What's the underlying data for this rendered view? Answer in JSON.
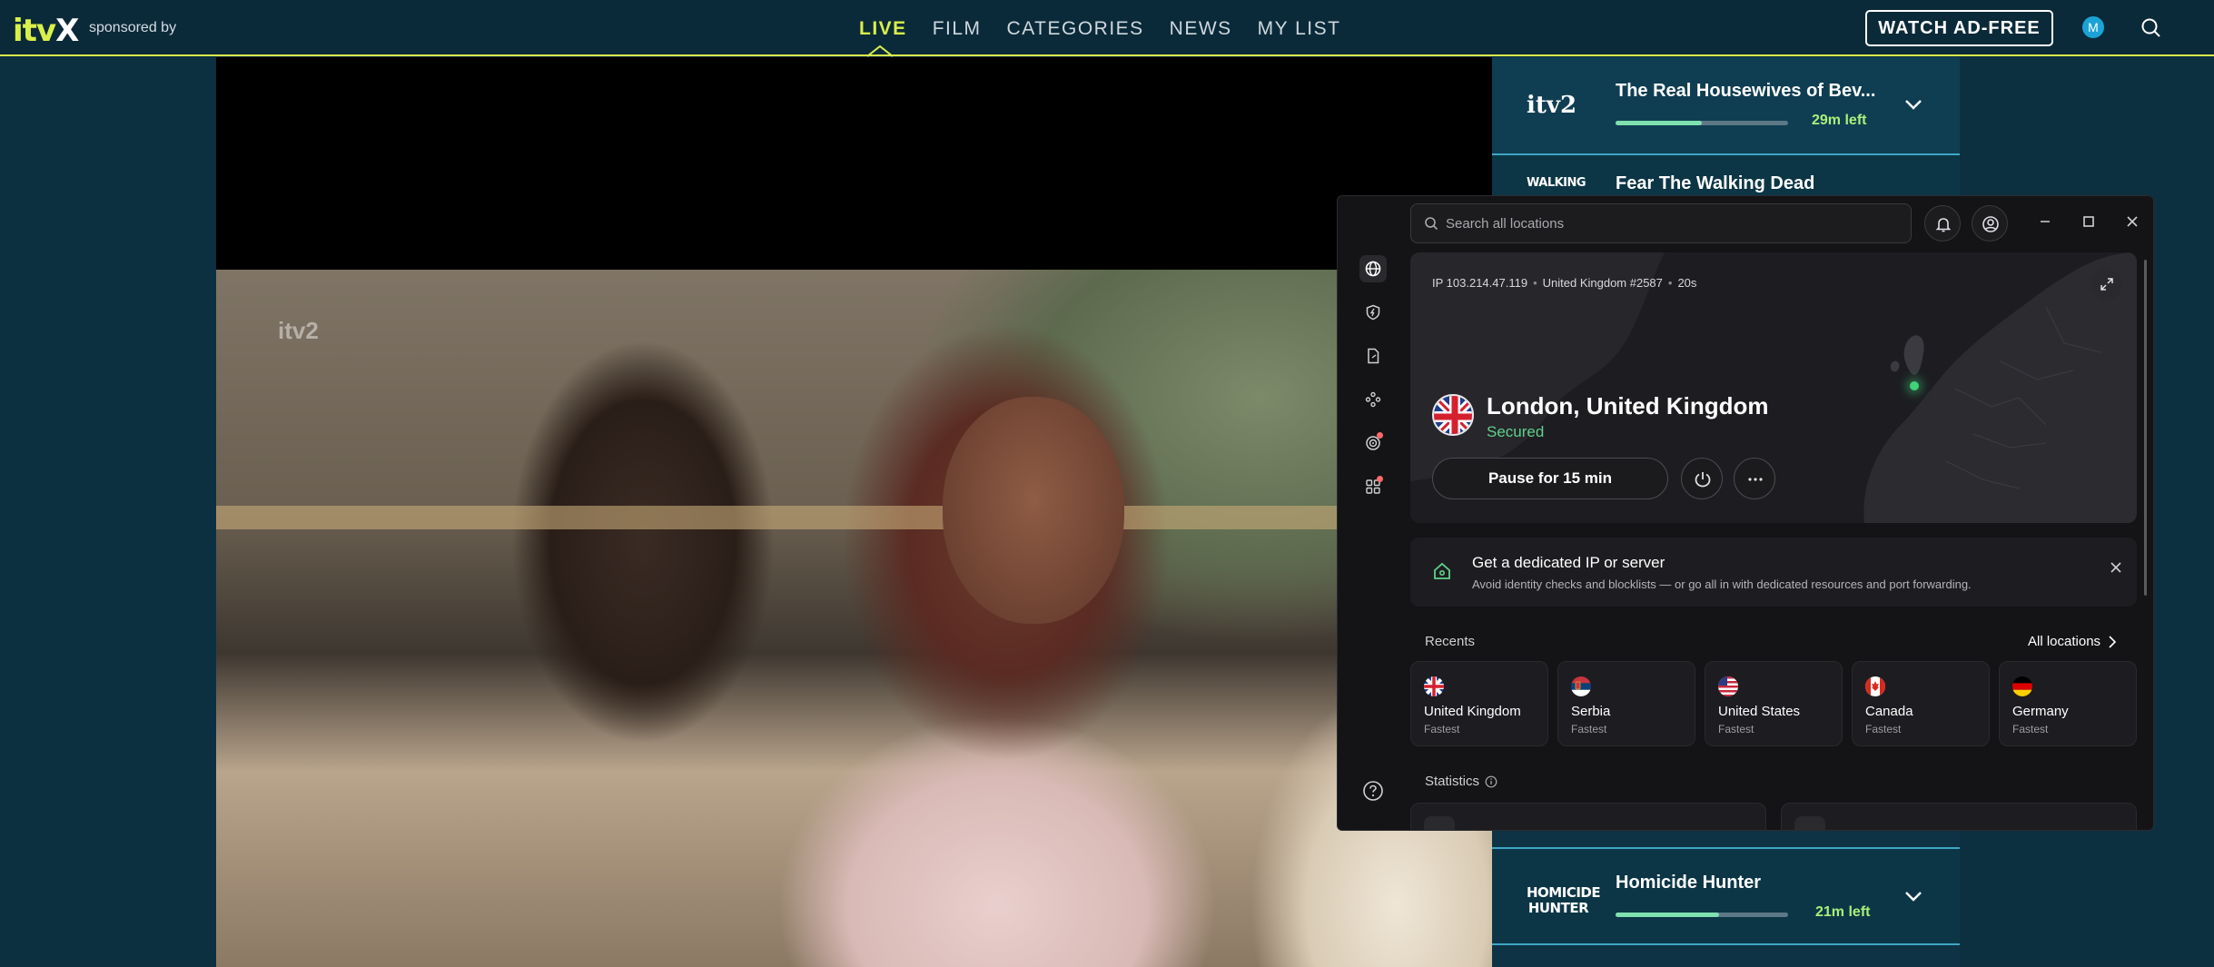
{
  "header": {
    "logo_main": "itv",
    "logo_x": "X",
    "sponsored": "sponsored by",
    "nav": [
      {
        "label": "LIVE",
        "active": true
      },
      {
        "label": "FILM",
        "active": false
      },
      {
        "label": "CATEGORIES",
        "active": false
      },
      {
        "label": "NEWS",
        "active": false
      },
      {
        "label": "MY LIST",
        "active": false
      }
    ],
    "watch_ad_free": "WATCH AD-FREE",
    "avatar_initial": "M",
    "accent": "#d9f04a"
  },
  "video": {
    "watermark": "itv2"
  },
  "schedule": {
    "items": [
      {
        "channel": "itv2",
        "title": "The Real Housewives of Bev...",
        "time_left": "29m left",
        "progress": 0.5
      },
      {
        "channel": "WALKING",
        "title": "Fear The Walking Dead",
        "time_left": "",
        "progress": 0
      },
      {
        "channel": "HOMICIDE HUNTER",
        "title": "Homicide Hunter",
        "time_left": "21m left",
        "progress": 0.6
      }
    ]
  },
  "vpn": {
    "search_placeholder": "Search all locations",
    "ip": "IP 103.214.47.119",
    "server": "United Kingdom #2587",
    "duration": "20s",
    "location": "London, United Kingdom",
    "status": "Secured",
    "status_color": "#5fd18b",
    "pause_label": "Pause for 15 min",
    "banner_title": "Get a dedicated IP or server",
    "banner_sub": "Avoid identity checks and blocklists — or go all in with dedicated resources and port forwarding.",
    "recents_label": "Recents",
    "all_locations": "All locations",
    "recents": [
      {
        "country": "United Kingdom",
        "sub": "Fastest"
      },
      {
        "country": "Serbia",
        "sub": "Fastest"
      },
      {
        "country": "United States",
        "sub": "Fastest"
      },
      {
        "country": "Canada",
        "sub": "Fastest"
      },
      {
        "country": "Germany",
        "sub": "Fastest"
      }
    ],
    "statistics_label": "Statistics"
  }
}
